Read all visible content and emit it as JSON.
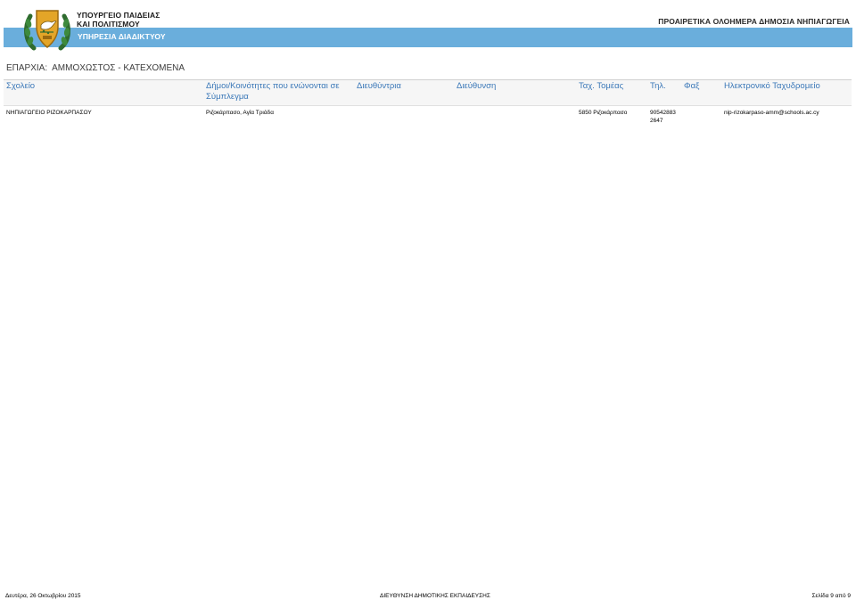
{
  "header": {
    "ministry_line1": "ΥΠΟΥΡΓΕΙΟ ΠΑΙΔΕΙΑΣ",
    "ministry_line2": "ΚΑΙ ΠΟΛΙΤΙΣΜΟΥ",
    "service": "ΥΠΗΡΕΣΙΑ ΔΙΑΔΙΚΤΥΟΥ",
    "report_title": "ΠΡΟΑΙΡΕΤΙΚΑ ΟΛΟΗΜΕΡΑ ΔΗΜΟΣΙΑ ΝΗΠΙΑΓΩΓΕΙΑ",
    "bar_color": "#6aaedc",
    "logo_icon": "cyprus-coat-of-arms-icon"
  },
  "province": {
    "label": "ΕΠΑΡΧΙΑ:",
    "value": "ΑΜΜΟΧΩΣΤΟΣ - ΚΑΤΕΧΟΜΕΝΑ"
  },
  "table": {
    "header_color": "#3b78b8",
    "columns": {
      "school": "Σχολείο",
      "municipalities_line1": "Δήμοι/Κοινότητες που ενώνονται σε",
      "municipalities_line2": "Σύμπλεγμα",
      "director": "Διευθύντρια",
      "address": "Διεύθυνση",
      "postal_code": "Ταχ. Τομέας",
      "phone": "Τηλ.",
      "fax": "Φαξ",
      "email": "Ηλεκτρονικό Ταχυδρομείο"
    },
    "rows": [
      {
        "school": "ΝΗΠΙΑΓΩΓΕΙΟ ΡΙΖΟΚΑΡΠΑΣΟΥ",
        "municipalities": "Ριζοκάρπασο, Αγία Τριάδα",
        "director": "",
        "address": "",
        "postal_code": "5850 Ριζοκάρπασο",
        "phone_line1": "90542883",
        "phone_line2": "2647",
        "fax": "",
        "email": "nip-rizokarpaso-amm@schools.ac.cy"
      }
    ]
  },
  "footer": {
    "date": "Δευτέρα, 26 Οκτωβρίου 2015",
    "department": "ΔΙΕΥΘΥΝΣΗ ΔΗΜΟΤΙΚΗΣ ΕΚΠΑΙΔΕΥΣΗΣ",
    "page": "Σελίδα 9 από 9"
  }
}
